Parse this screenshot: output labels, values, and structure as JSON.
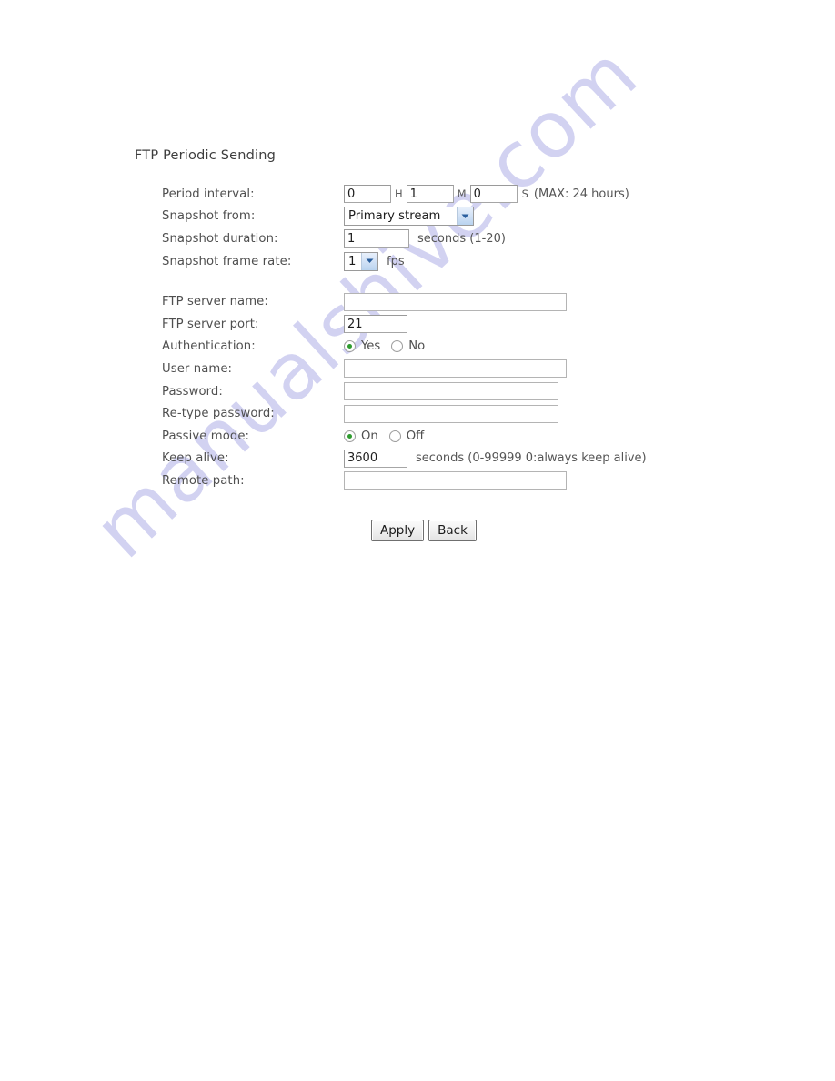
{
  "page": {
    "section_title": "FTP Periodic Sending",
    "watermark": "manualshive.com",
    "watermark_color": "#c9c9ef"
  },
  "form": {
    "period_interval": {
      "label": "Period interval:",
      "hours_value": "0",
      "hours_unit": "H",
      "minutes_value": "1",
      "minutes_unit": "M",
      "seconds_value": "0",
      "seconds_unit": "S",
      "hint": "(MAX: 24 hours)"
    },
    "snapshot_from": {
      "label": "Snapshot from:",
      "selected": "Primary stream",
      "options": [
        "Primary stream"
      ]
    },
    "snapshot_duration": {
      "label": "Snapshot duration:",
      "value": "1",
      "hint": "seconds (1-20)"
    },
    "snapshot_frame_rate": {
      "label": "Snapshot frame rate:",
      "selected": "1",
      "options": [
        "1"
      ],
      "unit": "fps"
    },
    "ftp_server_name": {
      "label": "FTP server name:",
      "value": "",
      "placeholder": ""
    },
    "ftp_server_port": {
      "label": "FTP server port:",
      "value": "21",
      "placeholder": ""
    },
    "authentication": {
      "label": "Authentication:",
      "selected": "Yes",
      "option_yes": "Yes",
      "option_no": "No"
    },
    "user_name": {
      "label": "User name:",
      "value": "",
      "placeholder": ""
    },
    "password": {
      "label": "Password:",
      "value": "",
      "placeholder": ""
    },
    "retype_password": {
      "label": "Re-type password:",
      "value": "",
      "placeholder": ""
    },
    "passive_mode": {
      "label": "Passive mode:",
      "selected": "On",
      "option_on": "On",
      "option_off": "Off"
    },
    "keep_alive": {
      "label": "Keep alive:",
      "value": "3600",
      "hint": "seconds (0-99999 0:always keep alive)"
    },
    "remote_path": {
      "label": "Remote path:",
      "value": "",
      "placeholder": ""
    }
  },
  "buttons": {
    "apply": "Apply",
    "back": "Back"
  }
}
